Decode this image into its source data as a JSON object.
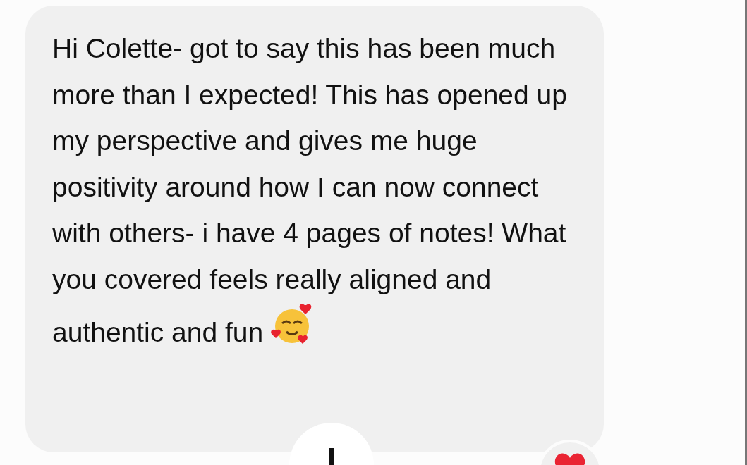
{
  "message": {
    "text": "Hi Colette- got to say this has been much more than I expected!  This has opened up my perspective and gives me huge positivity around how I can now connect with others- i have 4 pages of notes!  What you covered feels really aligned and authentic and fun"
  }
}
